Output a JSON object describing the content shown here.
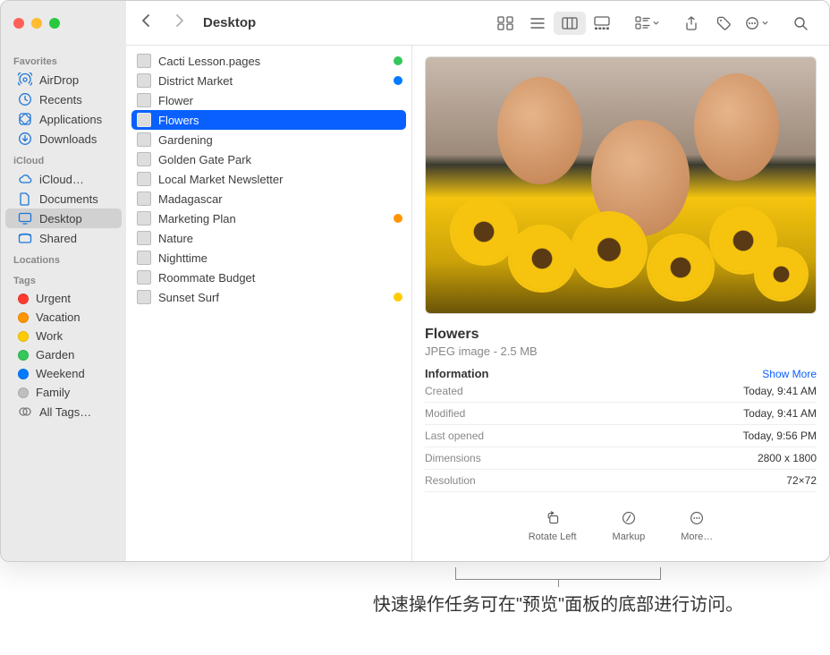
{
  "window_title": "Desktop",
  "sidebar": {
    "sections": [
      {
        "heading": "Favorites",
        "items": [
          {
            "label": "AirDrop",
            "icon": "airdrop"
          },
          {
            "label": "Recents",
            "icon": "clock"
          },
          {
            "label": "Applications",
            "icon": "apps"
          },
          {
            "label": "Downloads",
            "icon": "download"
          }
        ]
      },
      {
        "heading": "iCloud",
        "items": [
          {
            "label": "iCloud…",
            "icon": "cloud"
          },
          {
            "label": "Documents",
            "icon": "doc"
          },
          {
            "label": "Desktop",
            "icon": "desktop",
            "selected": true
          },
          {
            "label": "Shared",
            "icon": "shared"
          }
        ]
      },
      {
        "heading": "Locations",
        "items": []
      },
      {
        "heading": "Tags",
        "items": [
          {
            "label": "Urgent",
            "color": "#ff3b30"
          },
          {
            "label": "Vacation",
            "color": "#ff9500"
          },
          {
            "label": "Work",
            "color": "#ffcc00"
          },
          {
            "label": "Garden",
            "color": "#34c759"
          },
          {
            "label": "Weekend",
            "color": "#007aff"
          },
          {
            "label": "Family",
            "color": "#bfbfbf"
          },
          {
            "label": "All Tags…",
            "icon": "alltags"
          }
        ]
      }
    ]
  },
  "files": [
    {
      "name": "Cacti Lesson.pages",
      "tag": "#34c759"
    },
    {
      "name": "District Market",
      "tag": "#007aff"
    },
    {
      "name": "Flower"
    },
    {
      "name": "Flowers",
      "selected": true
    },
    {
      "name": "Gardening"
    },
    {
      "name": "Golden Gate Park"
    },
    {
      "name": "Local Market Newsletter"
    },
    {
      "name": "Madagascar"
    },
    {
      "name": "Marketing Plan",
      "tag": "#ff9500"
    },
    {
      "name": "Nature"
    },
    {
      "name": "Nighttime"
    },
    {
      "name": "Roommate Budget"
    },
    {
      "name": "Sunset Surf",
      "tag": "#ffcc00"
    }
  ],
  "preview": {
    "title": "Flowers",
    "subtitle": "JPEG image - 2.5 MB",
    "info_heading": "Information",
    "show_more": "Show More",
    "rows": [
      {
        "label": "Created",
        "value": "Today, 9:41 AM"
      },
      {
        "label": "Modified",
        "value": "Today, 9:41 AM"
      },
      {
        "label": "Last opened",
        "value": "Today, 9:56 PM"
      },
      {
        "label": "Dimensions",
        "value": "2800 x 1800"
      },
      {
        "label": "Resolution",
        "value": "72×72"
      }
    ],
    "quick_actions": [
      {
        "label": "Rotate Left",
        "icon": "rotate"
      },
      {
        "label": "Markup",
        "icon": "markup"
      },
      {
        "label": "More…",
        "icon": "more"
      }
    ]
  },
  "caption": "快速操作任务可在\"预览\"面板的底部进行访问。"
}
